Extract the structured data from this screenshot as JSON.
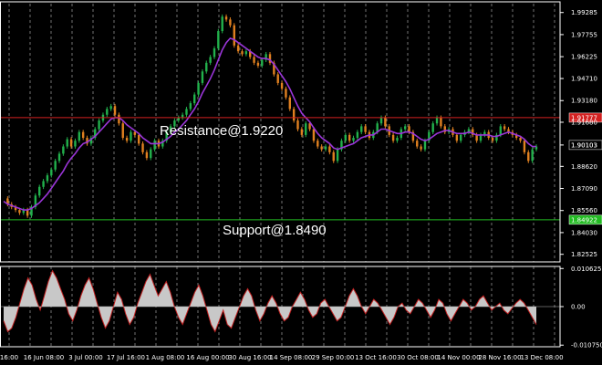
{
  "chart_data": {
    "type": "line",
    "panels": [
      "price",
      "oscillator"
    ],
    "price_axis": {
      "ticks": [
        "1.99285",
        "1.97755",
        "1.96225",
        "1.94710",
        "1.93180",
        "1.91680",
        "1.90103",
        "1.88620",
        "1.87090",
        "1.85560",
        "1.84030",
        "1.82525"
      ],
      "ylim": [
        1.82,
        1.999
      ]
    },
    "x_labels": [
      "16:00",
      "16 Jun 08:00",
      "3 Jul 00:00",
      "17 Jul 16:00",
      "1 Aug 08:00",
      "16 Aug 00:00",
      "30 Aug 16:00",
      "14 Sep 08:00",
      "29 Sep 00:00",
      "13 Oct 16:00",
      "30 Oct 08:00",
      "14 Nov 00:00",
      "28 Nov 16:00",
      "13 Dec 08:00"
    ],
    "grid": true,
    "resistance": {
      "label": "Resistance@1.9220",
      "value": 1.92,
      "tag": "1.91777",
      "color": "#d42020"
    },
    "support": {
      "label": "Support@1.8490",
      "value": 1.8492,
      "tag": "1.84922",
      "color": "#22bb22"
    },
    "current_price": {
      "tag": "1.90103",
      "value": 1.90103
    },
    "price_series": [
      1.864,
      1.86,
      1.858,
      1.856,
      1.854,
      1.856,
      1.852,
      1.858,
      1.866,
      1.872,
      1.876,
      1.88,
      1.884,
      1.89,
      1.895,
      1.9,
      1.905,
      1.9,
      1.904,
      1.91,
      1.906,
      1.902,
      1.906,
      1.912,
      1.918,
      1.922,
      1.926,
      1.928,
      1.922,
      1.916,
      1.906,
      1.904,
      1.91,
      1.908,
      1.902,
      1.896,
      1.892,
      1.898,
      1.904,
      1.9,
      1.904,
      1.91,
      1.914,
      1.918,
      1.92,
      1.922,
      1.926,
      1.93,
      1.936,
      1.944,
      1.952,
      1.958,
      1.962,
      1.968,
      1.98,
      1.99,
      1.988,
      1.984,
      1.97,
      1.966,
      1.964,
      1.966,
      1.962,
      1.958,
      1.956,
      1.96,
      1.964,
      1.958,
      1.95,
      1.944,
      1.94,
      1.934,
      1.926,
      1.918,
      1.912,
      1.908,
      1.916,
      1.912,
      1.904,
      1.9,
      1.898,
      1.9,
      1.896,
      1.89,
      1.898,
      1.904,
      1.908,
      1.904,
      1.906,
      1.91,
      1.914,
      1.91,
      1.906,
      1.91,
      1.916,
      1.92,
      1.914,
      1.908,
      1.904,
      1.906,
      1.912,
      1.914,
      1.91,
      1.904,
      1.9,
      1.898,
      1.904,
      1.91,
      1.916,
      1.92,
      1.914,
      1.91,
      1.912,
      1.908,
      1.904,
      1.908,
      1.91,
      1.912,
      1.908,
      1.904,
      1.908,
      1.91,
      1.906,
      1.904,
      1.908,
      1.914,
      1.912,
      1.91,
      1.908,
      1.906,
      1.904,
      1.896,
      1.89,
      1.898,
      1.9
    ],
    "moving_average": [
      1.862,
      1.86,
      1.859,
      1.858,
      1.857,
      1.856,
      1.856,
      1.857,
      1.859,
      1.861,
      1.864,
      1.867,
      1.871,
      1.875,
      1.879,
      1.883,
      1.888,
      1.892,
      1.895,
      1.899,
      1.902,
      1.903,
      1.905,
      1.907,
      1.91,
      1.913,
      1.916,
      1.919,
      1.92,
      1.92,
      1.918,
      1.915,
      1.913,
      1.911,
      1.909,
      1.906,
      1.904,
      1.902,
      1.902,
      1.902,
      1.903,
      1.905,
      1.907,
      1.91,
      1.912,
      1.915,
      1.918,
      1.922,
      1.926,
      1.931,
      1.937,
      1.942,
      1.947,
      1.953,
      1.96,
      1.967,
      1.972,
      1.975,
      1.974,
      1.972,
      1.97,
      1.968,
      1.966,
      1.964,
      1.962,
      1.961,
      1.961,
      1.96,
      1.957,
      1.953,
      1.949,
      1.945,
      1.94,
      1.934,
      1.928,
      1.923,
      1.92,
      1.917,
      1.913,
      1.909,
      1.906,
      1.904,
      1.902,
      1.899,
      1.898,
      1.899,
      1.9,
      1.901,
      1.902,
      1.904,
      1.906,
      1.907,
      1.908,
      1.908,
      1.91,
      1.912,
      1.912,
      1.911,
      1.91,
      1.909,
      1.909,
      1.91,
      1.91,
      1.909,
      1.907,
      1.905,
      1.904,
      1.905,
      1.907,
      1.909,
      1.91,
      1.911,
      1.911,
      1.91,
      1.909,
      1.909,
      1.909,
      1.91,
      1.909,
      1.908,
      1.908,
      1.908,
      1.908,
      1.907,
      1.907,
      1.908,
      1.909,
      1.91,
      1.909,
      1.908,
      1.907,
      1.905,
      1.902,
      1.9,
      1.9
    ],
    "oscillator": {
      "ticks": [
        "0.010625",
        "0.00",
        "-0.010750"
      ],
      "ylim": [
        -0.0112,
        0.0112
      ],
      "values": [
        -0.004,
        -0.007,
        -0.006,
        -0.003,
        0.001,
        0.005,
        0.008,
        0.006,
        0.002,
        -0.001,
        0.003,
        0.007,
        0.01,
        0.008,
        0.005,
        0.002,
        -0.002,
        -0.004,
        -0.001,
        0.003,
        0.006,
        0.008,
        0.005,
        0.001,
        -0.003,
        -0.006,
        -0.004,
        0.0,
        0.004,
        0.002,
        -0.002,
        -0.005,
        -0.003,
        0.001,
        0.004,
        0.007,
        0.009,
        0.006,
        0.003,
        0.005,
        0.007,
        0.004,
        0.0,
        -0.003,
        -0.005,
        -0.002,
        0.001,
        0.004,
        0.006,
        0.003,
        -0.001,
        -0.005,
        -0.007,
        -0.004,
        -0.001,
        -0.005,
        -0.006,
        -0.003,
        0.0,
        0.003,
        0.005,
        0.003,
        -0.001,
        -0.004,
        -0.002,
        0.001,
        0.003,
        0.001,
        -0.002,
        -0.004,
        -0.003,
        0.0,
        0.002,
        0.004,
        0.002,
        -0.001,
        -0.003,
        -0.002,
        0.001,
        0.002,
        0.0,
        -0.002,
        -0.004,
        -0.003,
        0.0,
        0.003,
        0.005,
        0.003,
        0.0,
        -0.002,
        0.0,
        0.002,
        0.001,
        -0.001,
        -0.003,
        -0.005,
        -0.003,
        0.0,
        0.001,
        -0.001,
        -0.002,
        0.0,
        0.002,
        0.001,
        -0.001,
        -0.003,
        -0.001,
        0.002,
        0.001,
        -0.002,
        -0.004,
        -0.002,
        0.0,
        0.002,
        0.001,
        -0.001,
        0.0,
        0.002,
        0.003,
        0.001,
        -0.001,
        0.0,
        0.001,
        -0.001,
        -0.002,
        -0.0005,
        0.001,
        0.002,
        0.001,
        -0.001,
        -0.003,
        -0.005
      ]
    }
  },
  "colors": {
    "background": "#000000",
    "grid": "#ffffff",
    "bull_candle": "#22b14c",
    "bear_candle": "#e08020",
    "moving_average": "#9a35d8",
    "osc_fill": "#c8c8c8",
    "osc_line": "#c02020"
  }
}
